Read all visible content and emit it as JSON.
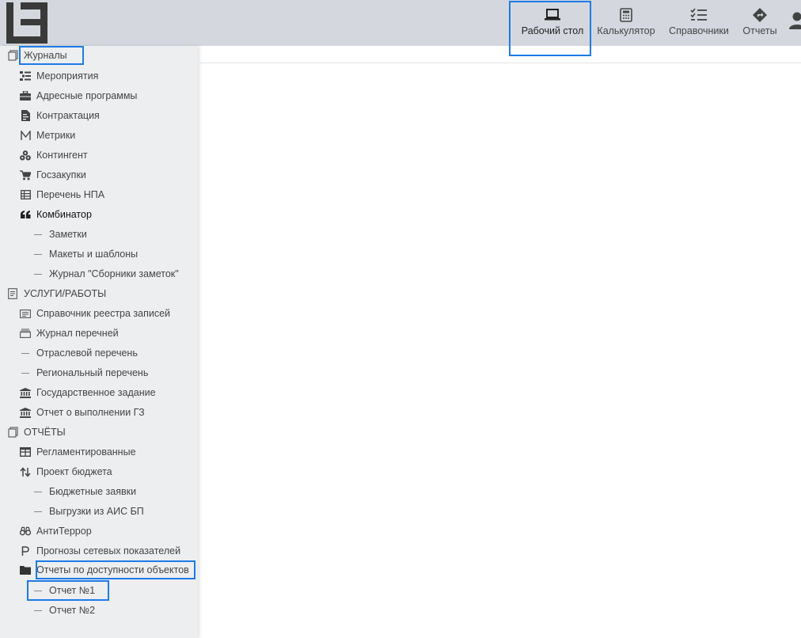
{
  "header": {
    "nav": [
      {
        "label": "Рабочий стол",
        "icon": "laptop-icon"
      },
      {
        "label": "Калькулятор",
        "icon": "calculator-icon"
      },
      {
        "label": "Справочники",
        "icon": "checklist-icon"
      },
      {
        "label": "Отчеты",
        "icon": "direction-sign-icon"
      }
    ]
  },
  "sidebar": {
    "journals": {
      "label": "Журналы",
      "items": [
        "Мероприятия",
        "Адресные программы",
        "Контрактация",
        "Метрики",
        "Контингент",
        "Госзакупки",
        "Перечень НПА",
        "Комбинатор"
      ],
      "combinator_children": [
        "Заметки",
        "Макеты и шаблоны",
        "Журнал \"Сборники заметок\""
      ]
    },
    "services": {
      "label": "УСЛУГИ/РАБОТЫ",
      "items": [
        "Справочник реестра записей",
        "Журнал перечней",
        "Отраслевой перечень",
        "Региональный перечень",
        "Государственное задание",
        "Отчет о выполнении ГЗ"
      ]
    },
    "reports": {
      "label": "ОТЧЁТЫ",
      "items": [
        "Регламентированные",
        "Проект бюджета"
      ],
      "budget_children": [
        "Бюджетные заявки",
        "Выгрузки из АИС БП"
      ],
      "more_items": [
        "АнтиТеррор",
        "Прогнозы сетевых показателей",
        "Отчеты по доступности объектов"
      ],
      "availability_children": [
        "Отчет №1",
        "Отчет №2"
      ]
    }
  },
  "colors": {
    "header_bg": "#d4d8de",
    "sidebar_bg": "#eceef0",
    "highlight": "#1e7be6"
  }
}
